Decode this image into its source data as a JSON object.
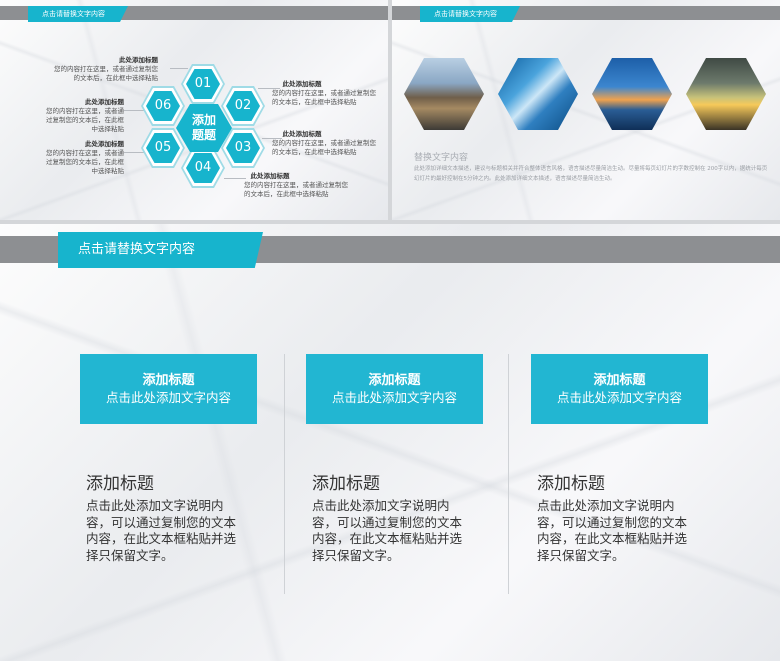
{
  "slide_a": {
    "tab_label": "点击请替换文字内容",
    "center_line1": "添加",
    "center_line2": "题题",
    "hex_numbers": [
      "01",
      "02",
      "03",
      "04",
      "05",
      "06"
    ],
    "notes": [
      {
        "title": "此处添加标题",
        "body": "您的内容打在这里，或者通过复制您的文本后，在此框中选择粘贴"
      },
      {
        "title": "此处添加标题",
        "body": "您的内容打在这里，或者通过复制您的文本后，在此框中选择粘贴"
      },
      {
        "title": "此处添加标题",
        "body": "您的内容打在这里，或者通过复制您的文本后，在此框中选择粘贴"
      },
      {
        "title": "此处添加标题",
        "body": "您的内容打在这里，或者通过复制您的文本后，在此框中选择粘贴"
      },
      {
        "title": "此处添加标题",
        "body": "您的内容打在这里，或者通过复制您的文本后，在此框中选择粘贴"
      },
      {
        "title": "此处添加标题",
        "body": "您的内容打在这里，或者通过复制您的文本后，在此框中选择粘贴"
      }
    ]
  },
  "slide_b": {
    "tab_label": "点击请替换文字内容",
    "title": "替换文字内容",
    "body": "此处添加详细文本描述，建议与标题相关并符合整体语言风格，语言描述尽量简洁生动。尽量将每页幻灯片的字数控制在 200字以内，据统计每页幻灯片的最好控制在5分钟之内。此处添加详细文本描述，语言描述尽量简洁生动。"
  },
  "slide_c": {
    "tab_label": "点击请替换文字内容",
    "columns": [
      {
        "card_title": "添加标题",
        "card_sub": "点击此处添加文字内容",
        "title": "添加标题",
        "body": "点击此处添加文字说明内容，可以通过复制您的文本内容，在此文本框粘贴并选择只保留文字。"
      },
      {
        "card_title": "添加标题",
        "card_sub": "点击此处添加文字内容",
        "title": "添加标题",
        "body": "点击此处添加文字说明内容，可以通过复制您的文本内容，在此文本框粘贴并选择只保留文字。"
      },
      {
        "card_title": "添加标题",
        "card_sub": "点击此处添加文字内容",
        "title": "添加标题",
        "body": "点击此处添加文字说明内容，可以通过复制您的文本内容，在此文本框粘贴并选择只保留文字。"
      }
    ]
  },
  "colors": {
    "accent": "#17b4cd",
    "bar_gray": "#8d8f92"
  }
}
